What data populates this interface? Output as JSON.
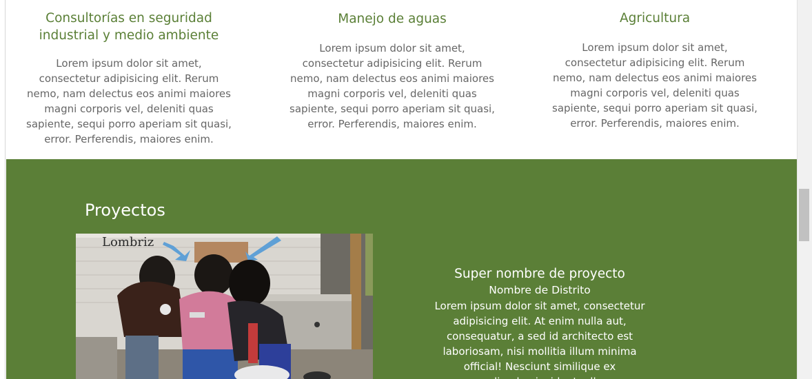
{
  "services": [
    {
      "title": "Consultorías en seguridad industrial y medio ambiente",
      "text": "Lorem ipsum dolor sit amet, consectetur adipisicing elit. Rerum nemo, nam delectus eos animi maiores magni corporis vel, deleniti quas sapiente, sequi porro aperiam sit quasi, error. Perferendis, maiores enim."
    },
    {
      "title": "Manejo de aguas",
      "text": "Lorem ipsum dolor sit amet, consectetur adipisicing elit. Rerum nemo, nam delectus eos animi maiores magni corporis vel, deleniti quas sapiente, sequi porro aperiam sit quasi, error. Perferendis, maiores enim."
    },
    {
      "title": "Agricultura",
      "text": "Lorem ipsum dolor sit amet, consectetur adipisicing elit. Rerum nemo, nam delectus eos animi maiores magni corporis vel, deleniti quas sapiente, sequi porro aperiam sit quasi, error. Perferendis, maiores enim."
    }
  ],
  "projects": {
    "heading": "Proyectos",
    "photo_wall_text": "Lombriz",
    "project": {
      "title": "Super nombre de proyecto",
      "district": "Nombre de Distrito",
      "description": "Lorem ipsum dolor sit amet, consectetur adipisicing elit. At enim nulla aut, consequatur, a sed id architecto est laboriosam, nisi mollitia illum minima official! Nesciunt similique ex repudiandae incidunt, ullam"
    }
  },
  "colors": {
    "brand_green": "#5b7f37",
    "heading_green": "#5a7f36",
    "body_text": "#666666"
  }
}
